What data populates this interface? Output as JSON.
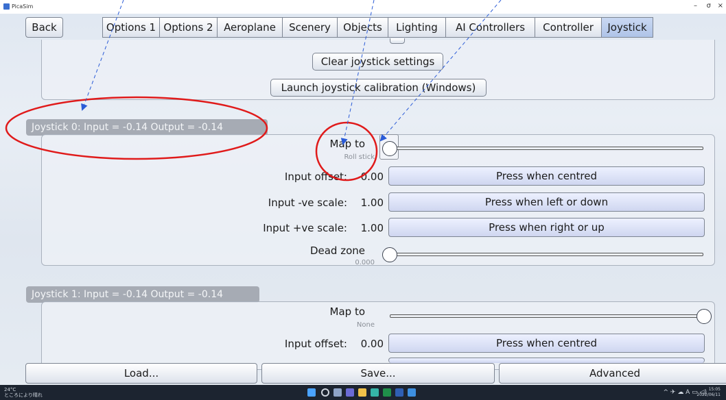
{
  "window": {
    "title": "PicaSim",
    "minimize": "–",
    "maximize": "σ",
    "close": "×"
  },
  "toolbar": {
    "back_label": "Back"
  },
  "tabs": [
    {
      "label": "Options 1"
    },
    {
      "label": "Options 2"
    },
    {
      "label": "Aeroplane"
    },
    {
      "label": "Scenery"
    },
    {
      "label": "Objects"
    },
    {
      "label": "Lighting"
    },
    {
      "label": "AI Controllers"
    },
    {
      "label": "Controller"
    },
    {
      "label": "Joystick",
      "active": true
    }
  ],
  "top_panel": {
    "clear_label": "Clear joystick settings",
    "calibrate_label": "Launch joystick calibration (Windows)"
  },
  "joystick0": {
    "header": "Joystick 0: Input = -0.14 Output = -0.14",
    "map_to_label": "Map to",
    "map_to_value": "Roll stick",
    "map_slider_level": 0.0,
    "input_offset_label": "Input offset:",
    "input_offset_value": "0.00",
    "centred_button": "Press when centred",
    "neg_scale_label": "Input -ve scale:",
    "neg_scale_value": "1.00",
    "left_down_button": "Press when left or down",
    "pos_scale_label": "Input +ve scale:",
    "pos_scale_value": "1.00",
    "right_up_button": "Press when right or up",
    "dead_zone_label": "Dead zone",
    "dead_zone_value": "0.000",
    "dead_zone_level": 0.0
  },
  "joystick1": {
    "header": "Joystick 1: Input = -0.14 Output = -0.14",
    "map_to_label": "Map to",
    "map_to_value": "None",
    "map_slider_level": 1.0,
    "input_offset_label": "Input offset:",
    "input_offset_value": "0.00",
    "centred_button": "Press when centred"
  },
  "bottom_bar": {
    "load_label": "Load...",
    "save_label": "Save...",
    "advanced_label": "Advanced"
  },
  "taskbar": {
    "weather_temp": "24°C",
    "weather_desc": "ところにより晴れ",
    "clock_time": "15:05",
    "clock_date": "2022/06/11"
  },
  "colors": {
    "annotation": "#e01a1a",
    "arrow": "#2a5bd7"
  }
}
